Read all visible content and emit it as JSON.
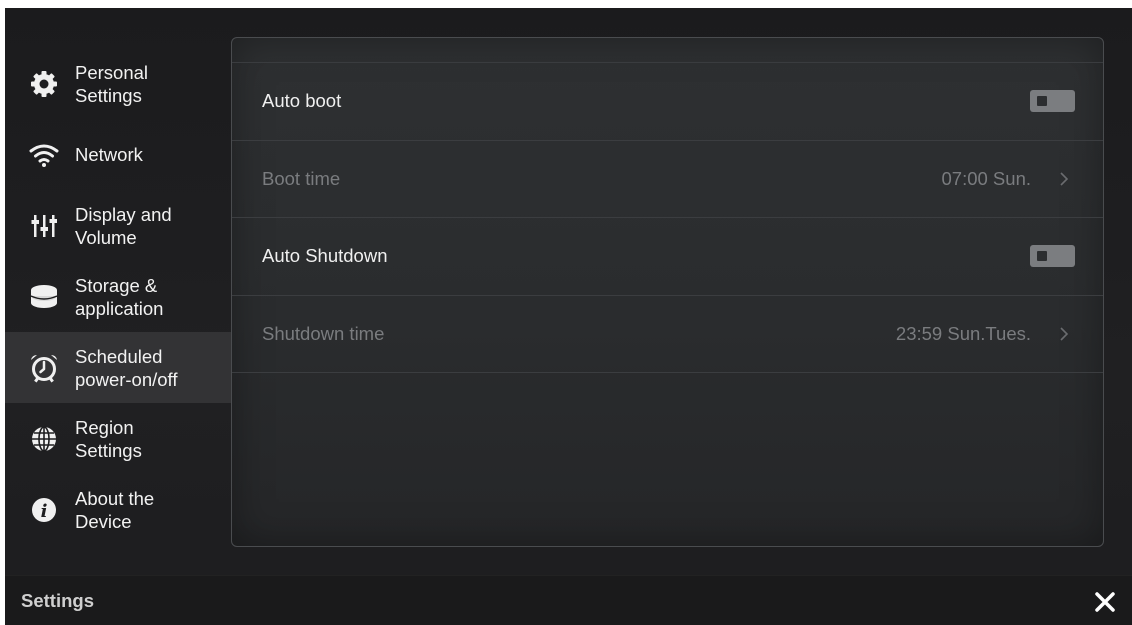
{
  "sidebar": {
    "items": [
      {
        "label": "Personal\nSettings",
        "icon": "gear-icon",
        "active": false
      },
      {
        "label": "Network",
        "icon": "wifi-icon",
        "active": false
      },
      {
        "label": "Display and\nVolume",
        "icon": "sliders-icon",
        "active": false
      },
      {
        "label": "Storage &\napplication",
        "icon": "storage-icon",
        "active": false
      },
      {
        "label": "Scheduled\npower-on/off",
        "icon": "alarm-clock-icon",
        "active": true
      },
      {
        "label": "Region\nSettings",
        "icon": "globe-icon",
        "active": false
      },
      {
        "label": "About the\nDevice",
        "icon": "info-icon",
        "active": false
      }
    ]
  },
  "main": {
    "rows": [
      {
        "title": "Auto boot",
        "type": "toggle",
        "enabled": true,
        "on": false
      },
      {
        "title": "Boot time",
        "type": "value",
        "enabled": false,
        "value": "07:00 Sun.",
        "icon": "chevron-right-icon"
      },
      {
        "title": "Auto Shutdown",
        "type": "toggle",
        "enabled": true,
        "on": false
      },
      {
        "title": "Shutdown time",
        "type": "value",
        "enabled": false,
        "value": "23:59 Sun.Tues.",
        "icon": "chevron-right-icon"
      }
    ]
  },
  "bottombar": {
    "title": "Settings",
    "close_icon": "close-icon"
  },
  "colors": {
    "background": "#1d1d1f",
    "active_item": "#333335",
    "panel": "#2b2d2f",
    "text": "#f0f0f0",
    "disabled_text": "#7a7c7f",
    "toggle_off": "#7b7d80"
  }
}
